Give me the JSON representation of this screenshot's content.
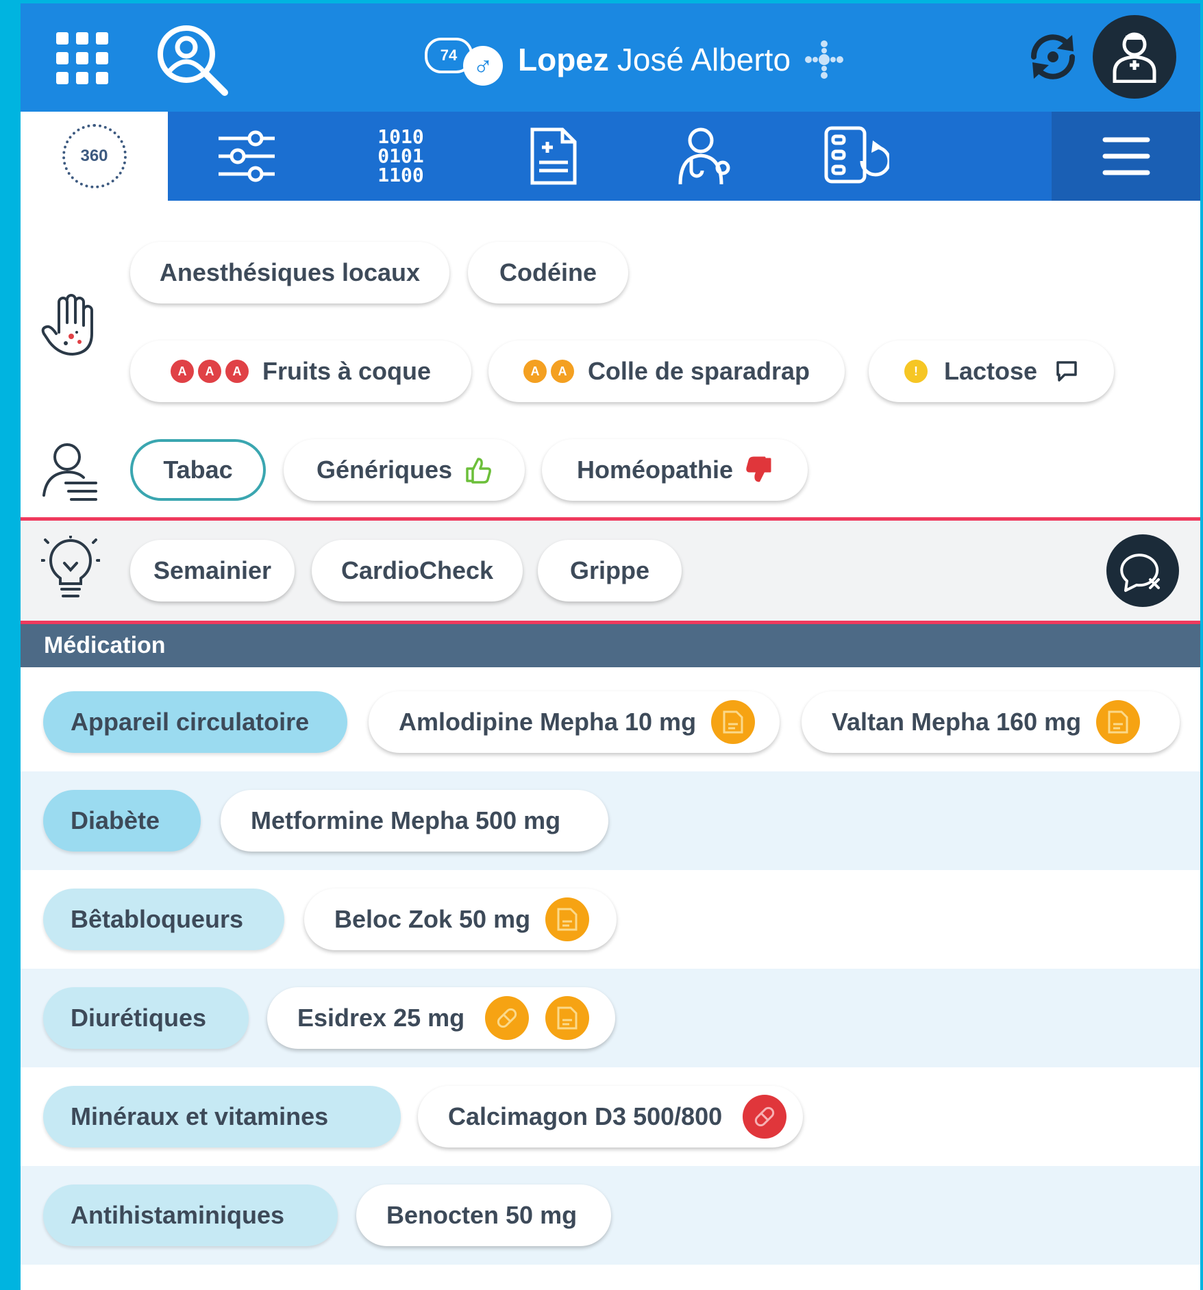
{
  "header": {
    "patient_age": "74",
    "patient_sex_symbol": "♂",
    "patient_last_name": "Lopez",
    "patient_first_names": "José Alberto"
  },
  "nav": {
    "tab_360_label": "360",
    "binary_lines": [
      "1010",
      "0101",
      "1100"
    ]
  },
  "allergies": {
    "row1": [
      {
        "label": "Anesthésiques locaux"
      },
      {
        "label": "Codéine"
      }
    ],
    "row2": [
      {
        "label": "Fruits à coque",
        "badges": [
          "A",
          "A",
          "A"
        ],
        "badge_color": "#e04146"
      },
      {
        "label": "Colle de sparadrap",
        "badges": [
          "A",
          "A"
        ],
        "badge_color": "#f4a021"
      },
      {
        "label": "Lactose",
        "badges": [
          "!"
        ],
        "badge_color": "#f6c624",
        "has_comment": true
      }
    ]
  },
  "preferences": [
    {
      "label": "Tabac",
      "selected": true
    },
    {
      "label": "Génériques",
      "icon": "thumbs-up-icon",
      "color": "#6cbf3a"
    },
    {
      "label": "Homéopathie",
      "icon": "thumbs-down-icon",
      "color": "#e0363b"
    }
  ],
  "suggestions": [
    {
      "label": "Semainier"
    },
    {
      "label": "CardioCheck"
    },
    {
      "label": "Grippe"
    }
  ],
  "medication": {
    "title": "Médication",
    "rows": [
      {
        "category": "Appareil circulatoire",
        "active": true,
        "drugs": [
          {
            "name": "Amlodipine Mepha 10 mg",
            "icons": [
              "prescription-icon"
            ]
          },
          {
            "name": "Valtan Mepha 160 mg",
            "icons": [
              "prescription-icon"
            ]
          }
        ]
      },
      {
        "category": "Diabète",
        "active": true,
        "drugs": [
          {
            "name": "Metformine Mepha 500 mg",
            "icons": []
          }
        ]
      },
      {
        "category": "Bêtabloqueurs",
        "active": false,
        "drugs": [
          {
            "name": "Beloc Zok 50 mg",
            "icons": [
              "prescription-icon"
            ]
          }
        ]
      },
      {
        "category": "Diurétiques",
        "active": false,
        "drugs": [
          {
            "name": "Esidrex 25 mg",
            "icons": [
              "pill-icon",
              "prescription-icon"
            ]
          }
        ]
      },
      {
        "category": "Minéraux et vitamines",
        "active": false,
        "drugs": [
          {
            "name": "Calcimagon D3 500/800",
            "icons": [
              "pill-icon-red"
            ]
          }
        ]
      },
      {
        "category": "Antihistaminiques",
        "active": false,
        "drugs": [
          {
            "name": "Benocten 50 mg",
            "icons": []
          }
        ]
      }
    ]
  },
  "colors": {
    "header_blue": "#1b88e1",
    "nav_blue": "#1b6fd1",
    "accent_red": "#ef3a5d",
    "section_header": "#4d6a86",
    "category_chip": "#c6e9f4",
    "warning_orange": "#f6a313"
  }
}
